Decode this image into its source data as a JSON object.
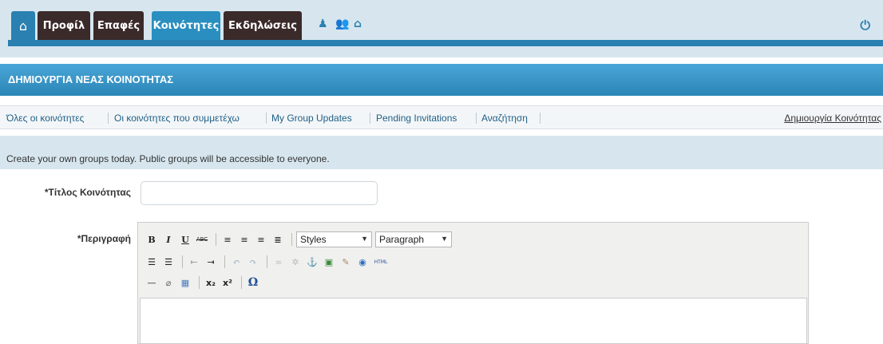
{
  "nav": {
    "tabs": [
      {
        "label": "Προφίλ",
        "active": false
      },
      {
        "label": "Επαφές",
        "active": false
      },
      {
        "label": "Κοινότητες",
        "active": true
      },
      {
        "label": "Εκδηλώσεις",
        "active": false
      }
    ],
    "icons": [
      "home-icon",
      "bell-icon",
      "people-icon",
      "mail-icon",
      "power-icon"
    ],
    "accent": "#2a80b0",
    "tab_color": "#3b2a2a"
  },
  "section": {
    "title": "ΔΗΜΙΟΥΡΓΙΑ ΝΕΑΣ ΚΟΙΝΟΤΗΤΑΣ"
  },
  "subnav": {
    "items": [
      "Όλες οι κοινότητες",
      "Οι κοινότητες που συμμετέχω",
      "My Group Updates",
      "Pending Invitations",
      "Αναζήτηση"
    ],
    "create": "Δημιουργία Κοινότητας"
  },
  "info": {
    "text": "Create your own groups today. Public groups will be accessible to everyone."
  },
  "form": {
    "title_label": "*Τίτλος Κοινότητας",
    "title_value": "",
    "desc_label": "*Περιγραφή"
  },
  "editor": {
    "styles_value": "Styles",
    "format_value": "Paragraph",
    "bold": "B",
    "italic": "I",
    "underline": "U",
    "strike": "ABC",
    "html": "HTML",
    "omega": "Ω"
  }
}
